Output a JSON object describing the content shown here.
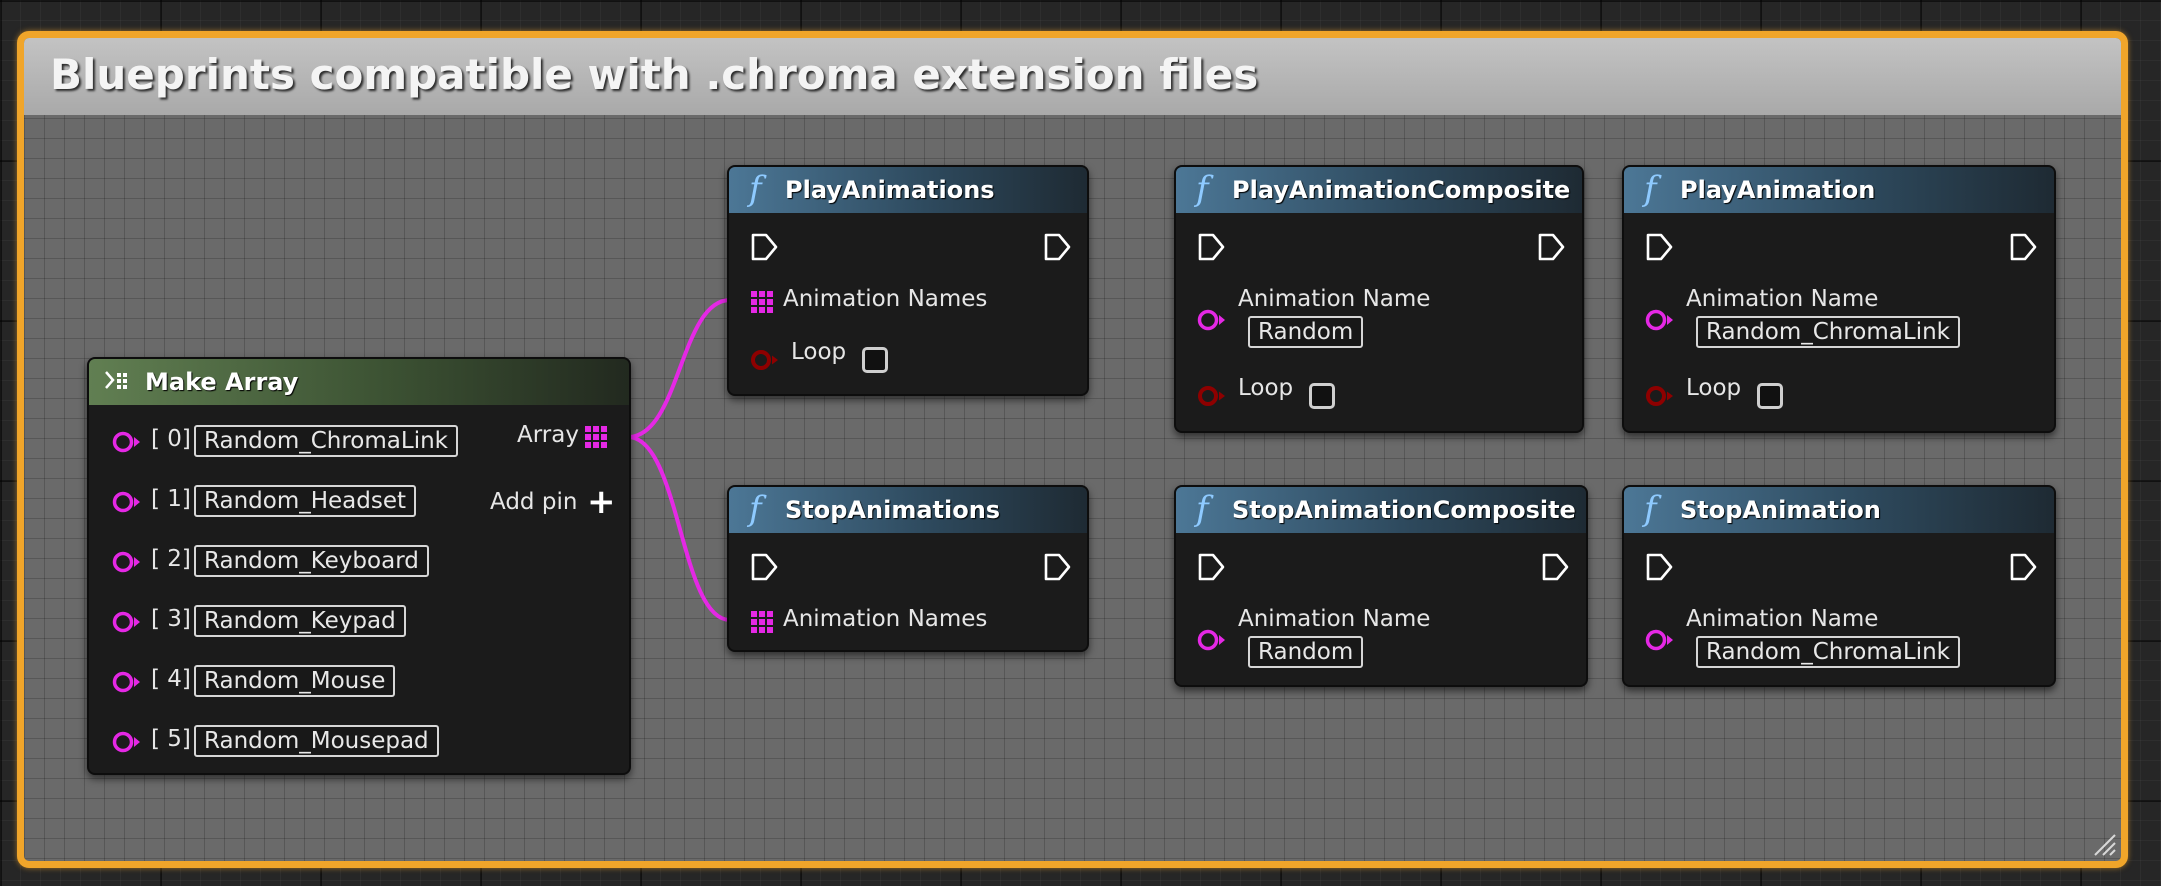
{
  "comment": {
    "title": "Blueprints compatible with .chroma extension files",
    "border_color": "#f0a52a"
  },
  "colors": {
    "array_pin": "#e528e5",
    "bool_pin": "#8e0000",
    "exec_pin": "#ffffff",
    "function_header": "#4c7796",
    "make_array_header": "#617f52"
  },
  "make_array": {
    "title": "Make Array",
    "output_label": "Array",
    "add_pin_label": "Add pin",
    "items": [
      {
        "index": "[ 0]",
        "value": "Random_ChromaLink"
      },
      {
        "index": "[ 1]",
        "value": "Random_Headset"
      },
      {
        "index": "[ 2]",
        "value": "Random_Keyboard"
      },
      {
        "index": "[ 3]",
        "value": "Random_Keypad"
      },
      {
        "index": "[ 4]",
        "value": "Random_Mouse"
      },
      {
        "index": "[ 5]",
        "value": "Random_Mousepad"
      }
    ]
  },
  "nodes": {
    "play_animations": {
      "title": "PlayAnimations",
      "pin_names": "Animation Names",
      "pin_loop": "Loop"
    },
    "stop_animations": {
      "title": "StopAnimations",
      "pin_names": "Animation Names"
    },
    "play_animation_composite": {
      "title": "PlayAnimationComposite",
      "pin_name": "Animation Name",
      "value": "Random",
      "pin_loop": "Loop"
    },
    "stop_animation_composite": {
      "title": "StopAnimationComposite",
      "pin_name": "Animation Name",
      "value": "Random"
    },
    "play_animation": {
      "title": "PlayAnimation",
      "pin_name": "Animation Name",
      "value": "Random_ChromaLink",
      "pin_loop": "Loop"
    },
    "stop_animation": {
      "title": "StopAnimation",
      "pin_name": "Animation Name",
      "value": "Random_ChromaLink"
    }
  }
}
